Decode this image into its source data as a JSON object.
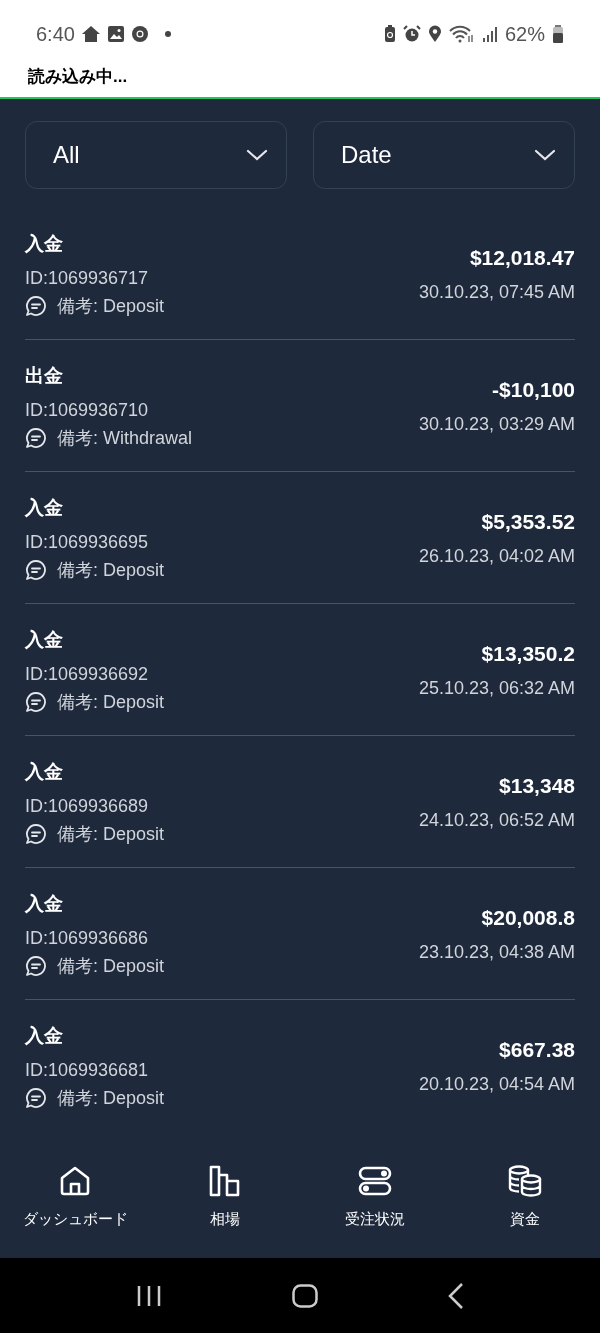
{
  "status_bar": {
    "time": "6:40",
    "battery": "62%"
  },
  "header": {
    "title": "読み込み中..."
  },
  "filters": [
    {
      "value": "All"
    },
    {
      "value": "Date"
    }
  ],
  "transactions": [
    {
      "type": "入金",
      "id": "ID:1069936717",
      "memo": "備考: Deposit",
      "amount": "$12,018.47",
      "date": "30.10.23, 07:45 AM"
    },
    {
      "type": "出金",
      "id": "ID:1069936710",
      "memo": "備考: Withdrawal",
      "amount": "-$10,100",
      "date": "30.10.23, 03:29 AM"
    },
    {
      "type": "入金",
      "id": "ID:1069936695",
      "memo": "備考: Deposit",
      "amount": "$5,353.52",
      "date": "26.10.23, 04:02 AM"
    },
    {
      "type": "入金",
      "id": "ID:1069936692",
      "memo": "備考: Deposit",
      "amount": "$13,350.2",
      "date": "25.10.23, 06:32 AM"
    },
    {
      "type": "入金",
      "id": "ID:1069936689",
      "memo": "備考: Deposit",
      "amount": "$13,348",
      "date": "24.10.23, 06:52 AM"
    },
    {
      "type": "入金",
      "id": "ID:1069936686",
      "memo": "備考: Deposit",
      "amount": "$20,008.8",
      "date": "23.10.23, 04:38 AM"
    },
    {
      "type": "入金",
      "id": "ID:1069936681",
      "memo": "備考: Deposit",
      "amount": "$667.38",
      "date": "20.10.23, 04:54 AM"
    }
  ],
  "bottom_nav": [
    {
      "label": "ダッシュボード",
      "kind": "home",
      "selected": false
    },
    {
      "label": "相場",
      "kind": "chart",
      "selected": false
    },
    {
      "label": "受注状況",
      "kind": "toggles",
      "selected": false
    },
    {
      "label": "資金",
      "kind": "coins",
      "selected": false
    }
  ]
}
